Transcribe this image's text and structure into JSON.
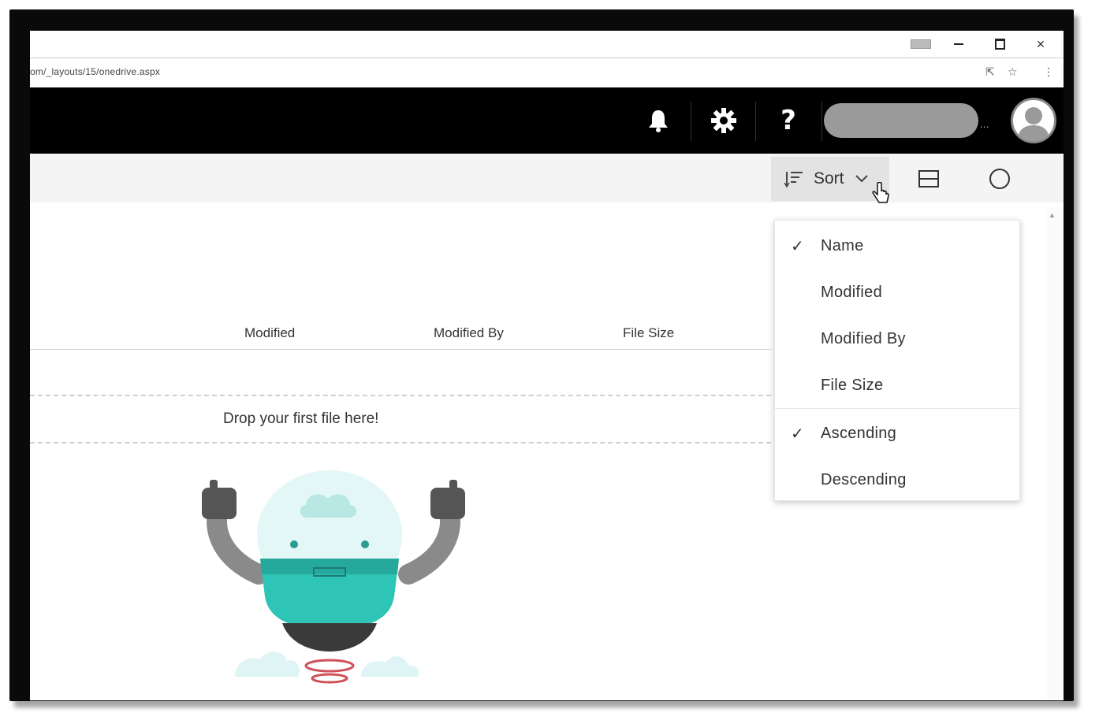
{
  "browser": {
    "url": "om/_layouts/15/onedrive.aspx",
    "window_controls": [
      "minimize",
      "maximize",
      "close"
    ]
  },
  "appbar": {
    "icons": [
      "bell-icon",
      "gear-icon",
      "help-icon"
    ],
    "help_label": "?",
    "ellipsis": "..."
  },
  "commandbar": {
    "sort_label": "Sort",
    "icons": [
      "sort-icon",
      "chevron-down-icon",
      "view-layout-icon",
      "info-circle-icon"
    ]
  },
  "list": {
    "columns": [
      "Modified",
      "Modified By",
      "File Size"
    ],
    "drop_text": "Drop your first file here!"
  },
  "sort_menu": {
    "items": [
      {
        "label": "Name",
        "checked": true
      },
      {
        "label": "Modified",
        "checked": false
      },
      {
        "label": "Modified By",
        "checked": false
      },
      {
        "label": "File Size",
        "checked": false
      },
      {
        "label": "Ascending",
        "checked": true
      },
      {
        "label": "Descending",
        "checked": false
      }
    ],
    "check_glyph": "✓"
  },
  "colors": {
    "appbar_bg": "#000000",
    "commandbar_bg": "#f4f4f4",
    "accent_teal": "#2ec4b6"
  }
}
